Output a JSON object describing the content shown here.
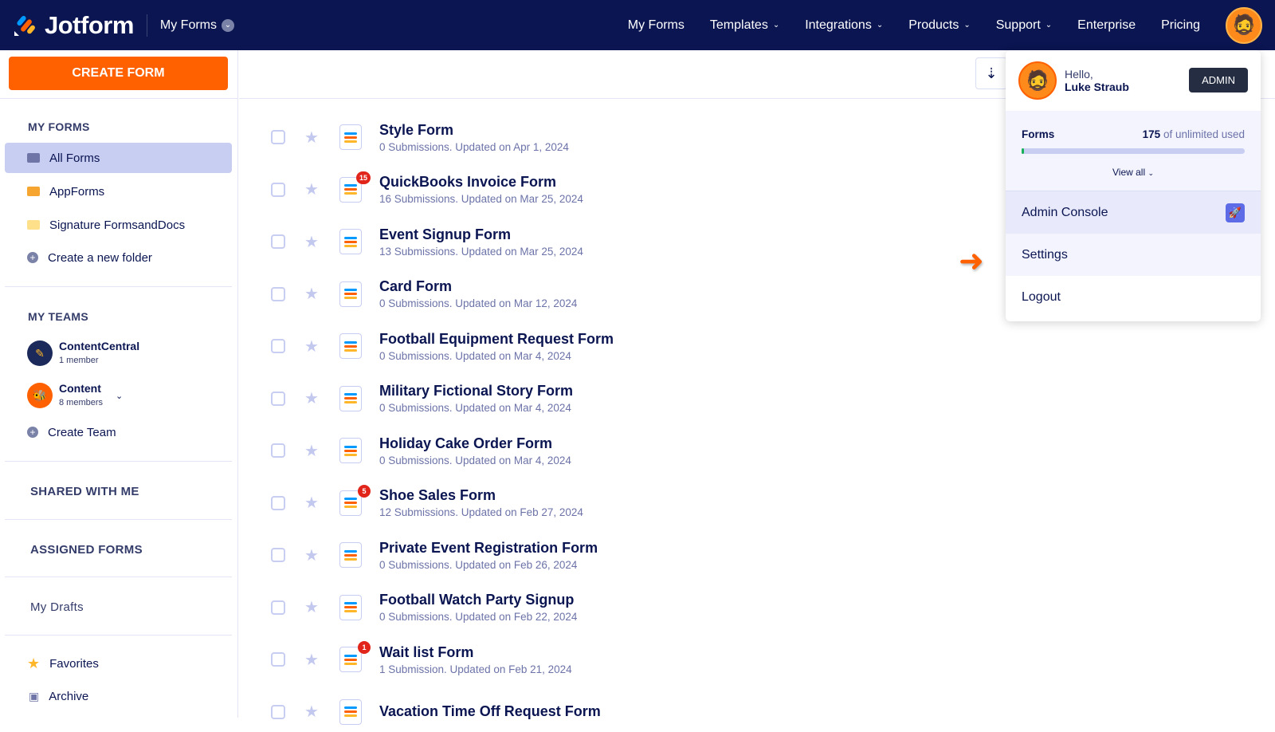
{
  "header": {
    "brand": "Jotform",
    "context": "My Forms",
    "nav": [
      {
        "label": "My Forms",
        "dropdown": false
      },
      {
        "label": "Templates",
        "dropdown": true
      },
      {
        "label": "Integrations",
        "dropdown": true
      },
      {
        "label": "Products",
        "dropdown": true
      },
      {
        "label": "Support",
        "dropdown": true
      },
      {
        "label": "Enterprise",
        "dropdown": false
      },
      {
        "label": "Pricing",
        "dropdown": false
      }
    ]
  },
  "sidebar": {
    "create_label": "CREATE FORM",
    "my_forms_heading": "MY FORMS",
    "folders": [
      {
        "label": "All Forms",
        "color": "#6f76a7"
      },
      {
        "label": "AppForms",
        "color": "#f7a531"
      },
      {
        "label": "Signature FormsandDocs",
        "color": "#ffe08a"
      }
    ],
    "create_folder": "Create a new folder",
    "my_teams_heading": "MY TEAMS",
    "teams": [
      {
        "name": "ContentCentral",
        "members": "1 member"
      },
      {
        "name": "Content",
        "members": "8 members"
      }
    ],
    "create_team": "Create Team",
    "shared": "SHARED WITH ME",
    "assigned": "ASSIGNED FORMS",
    "drafts": "My Drafts",
    "favorites": "Favorites",
    "archive": "Archive"
  },
  "forms": [
    {
      "title": "Style Form",
      "sub": "0 Submissions. Updated on Apr 1, 2024",
      "badge": null
    },
    {
      "title": "QuickBooks Invoice Form",
      "sub": "16 Submissions. Updated on Mar 25, 2024",
      "badge": "15"
    },
    {
      "title": "Event Signup Form",
      "sub": "13 Submissions. Updated on Mar 25, 2024",
      "badge": null
    },
    {
      "title": "Card Form",
      "sub": "0 Submissions. Updated on Mar 12, 2024",
      "badge": null
    },
    {
      "title": "Football Equipment Request Form",
      "sub": "0 Submissions. Updated on Mar 4, 2024",
      "badge": null
    },
    {
      "title": "Military Fictional Story Form",
      "sub": "0 Submissions. Updated on Mar 4, 2024",
      "badge": null
    },
    {
      "title": "Holiday Cake Order Form",
      "sub": "0 Submissions. Updated on Mar 4, 2024",
      "badge": null
    },
    {
      "title": "Shoe Sales Form",
      "sub": "12 Submissions. Updated on Feb 27, 2024",
      "badge": "5"
    },
    {
      "title": "Private Event Registration Form",
      "sub": "0 Submissions. Updated on Feb 26, 2024",
      "badge": null
    },
    {
      "title": "Football Watch Party Signup",
      "sub": "0 Submissions. Updated on Feb 22, 2024",
      "badge": null
    },
    {
      "title": "Wait list Form",
      "sub": "1 Submission. Updated on Feb 21, 2024",
      "badge": "1"
    },
    {
      "title": "Vacation Time Off Request Form",
      "sub": "",
      "badge": null
    }
  ],
  "account_menu": {
    "greeting": "Hello,",
    "user": "Luke Straub",
    "role_badge": "ADMIN",
    "usage_label": "Forms",
    "usage_count": "175",
    "usage_suffix": " of unlimited used",
    "usage_percent": 1,
    "view_all": "View all",
    "items": [
      "Admin Console",
      "Settings",
      "Logout"
    ]
  }
}
